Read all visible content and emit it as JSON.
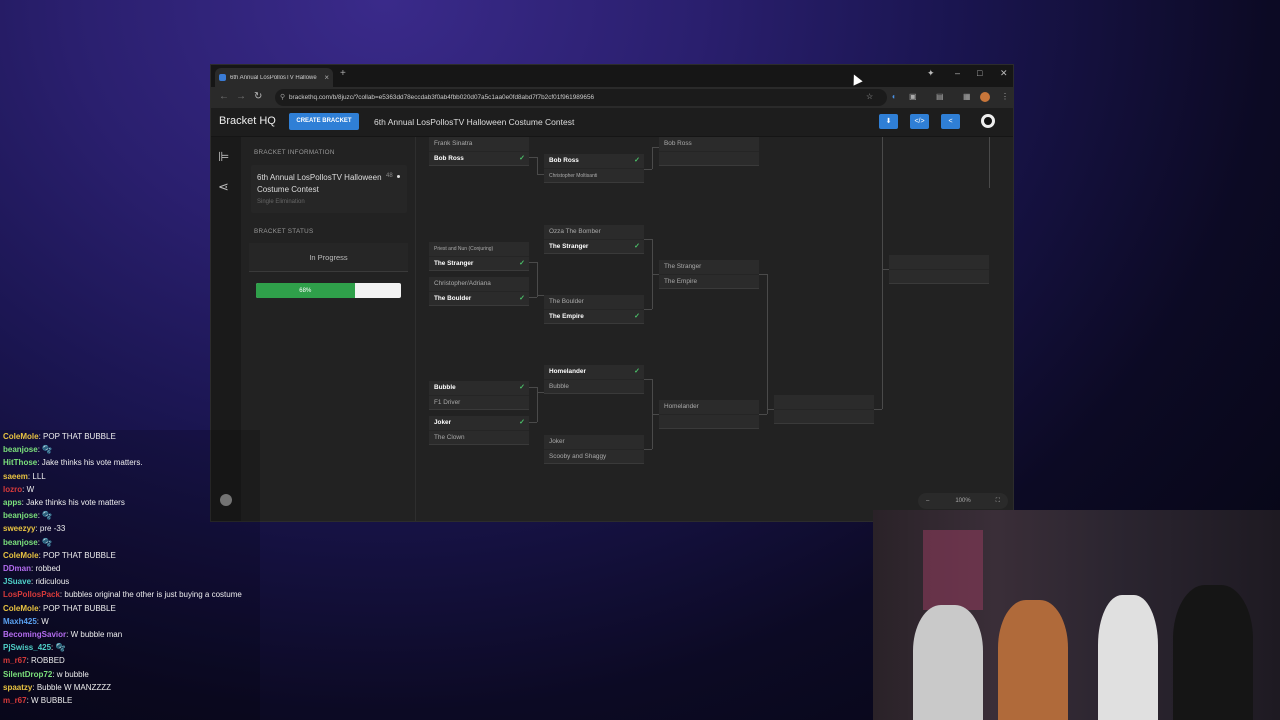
{
  "browser": {
    "tab_title": "6th Annual LosPollosTV Hallowe",
    "new_tab": "+",
    "url": "brackethq.com/b/8juzc/?collab=e5363dd78eccdab3f0ab4fbb020d07a5c1aa0e0fd8abd7f7b2cf01f961989656",
    "controls": {
      "sparkle": "✦",
      "minimize": "–",
      "maximize": "□",
      "close": "✕"
    }
  },
  "app": {
    "brand": "Bracket HQ",
    "create_button": "CREATE BRACKET",
    "title": "6th Annual LosPollosTV Halloween Costume Contest",
    "actions": {
      "download": "⬇",
      "embed": "</>",
      "share": "<"
    }
  },
  "sidebar": {
    "info_heading": "BRACKET INFORMATION",
    "bracket_name": "6th Annual LosPollosTV Halloween Costume Contest",
    "bracket_type": "Single Elimination",
    "count": "48",
    "status_heading": "BRACKET STATUS",
    "status": "In Progress",
    "progress_label": "68%",
    "progress_fraction": 0.68
  },
  "bracket": {
    "round1": [
      {
        "top": "Frank Sinatra",
        "bottom": "Bob Ross",
        "winner": "bottom"
      },
      {
        "top": "Priest and Nun (Conjuring)",
        "bottom": "The Stranger",
        "winner": "bottom"
      },
      {
        "top": "Christopher/Adriana",
        "bottom": "The Boulder",
        "winner": "bottom"
      },
      {
        "top": "Bubble",
        "bottom": "F1 Driver",
        "winner": "top"
      },
      {
        "top": "Joker",
        "bottom": "The Clown",
        "winner": "top"
      }
    ],
    "round2": [
      {
        "top": "Bob Ross",
        "bottom": "Christopher Moltisanti",
        "winner": "top"
      },
      {
        "top": "Ozza The Bomber",
        "bottom": "The Stranger",
        "winner": "bottom"
      },
      {
        "top": "The Boulder",
        "bottom": "The Empire",
        "winner": "bottom"
      },
      {
        "top": "Homelander",
        "bottom": "Bubble",
        "winner": "top"
      },
      {
        "top": "Joker",
        "bottom": "Scooby and Shaggy",
        "winner": ""
      }
    ],
    "round3": [
      {
        "top": "Bob Ross",
        "bottom": ""
      },
      {
        "top": "The Stranger",
        "bottom": "The Empire"
      },
      {
        "top": "Homelander",
        "bottom": ""
      }
    ],
    "zoom": "100%"
  },
  "chat": [
    {
      "user": "ColeMole",
      "color": "#e8c341",
      "msg": "POP THAT BUBBLE"
    },
    {
      "user": "beanjose",
      "color": "#7be07b",
      "msg": "🫧"
    },
    {
      "user": "HitThose",
      "color": "#7be07b",
      "msg": "Jake thinks his vote matters."
    },
    {
      "user": "saeem",
      "color": "#e8c341",
      "msg": "LLL"
    },
    {
      "user": "lozro",
      "color": "#d83a3a",
      "msg": "W"
    },
    {
      "user": "apps",
      "color": "#7be07b",
      "msg": "Jake thinks his vote matters"
    },
    {
      "user": "beanjose",
      "color": "#7be07b",
      "msg": "🫧"
    },
    {
      "user": "sweezyy",
      "color": "#e8c341",
      "msg": "pre -33"
    },
    {
      "user": "beanjose",
      "color": "#7be07b",
      "msg": "🫧"
    },
    {
      "user": "ColeMole",
      "color": "#e8c341",
      "msg": "POP THAT BUBBLE"
    },
    {
      "user": "DDman",
      "color": "#b46cf0",
      "msg": "robbed"
    },
    {
      "user": "JSuave",
      "color": "#4fd0c8",
      "msg": "ridiculous"
    },
    {
      "user": "LosPollosPack",
      "color": "#d83a3a",
      "msg": "bubbles original the other is just buying a costume"
    },
    {
      "user": "ColeMole",
      "color": "#e8c341",
      "msg": "POP THAT BUBBLE"
    },
    {
      "user": "Maxh425",
      "color": "#5aa0f0",
      "msg": "W"
    },
    {
      "user": "BecomingSavior",
      "color": "#b46cf0",
      "msg": "W bubble man"
    },
    {
      "user": "PjSwiss_425",
      "color": "#4fd0c8",
      "msg": "🫧"
    },
    {
      "user": "m_r67",
      "color": "#d83a3a",
      "msg": "ROBBED"
    },
    {
      "user": "SilentDrop72",
      "color": "#7be07b",
      "msg": "w bubble"
    },
    {
      "user": "spaatzy",
      "color": "#e8c341",
      "msg": "Bubble W MANZZZZ"
    },
    {
      "user": "m_r67",
      "color": "#d83a3a",
      "msg": "W BUBBLE"
    }
  ]
}
